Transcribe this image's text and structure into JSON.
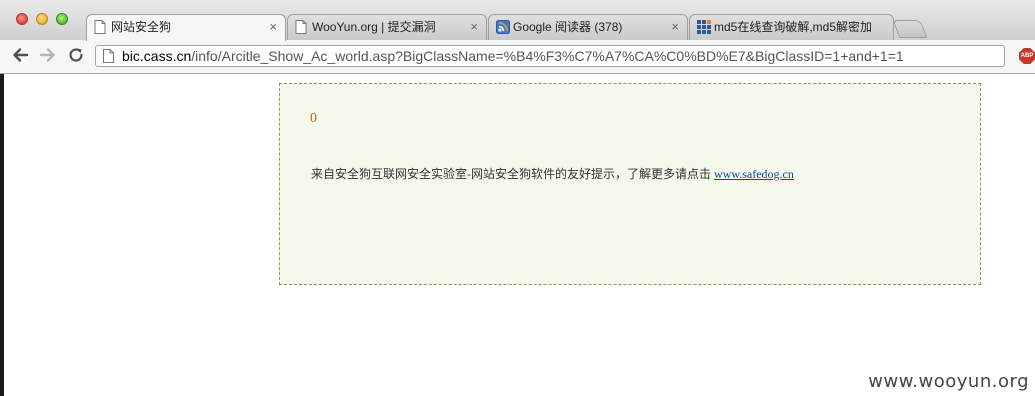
{
  "browser": {
    "tabs": [
      {
        "label": "网站安全狗",
        "icon": "page-icon",
        "active": true
      },
      {
        "label": "WooYun.org | 提交漏洞",
        "icon": "page-icon",
        "active": false
      },
      {
        "label": "Google 阅读器 (378)",
        "icon": "google-reader-icon",
        "active": false
      },
      {
        "label": "md5在线查询破解,md5解密加",
        "icon": "grid-icon",
        "active": false
      }
    ],
    "tab_close_glyph": "×",
    "url_host": "bic.cass.cn",
    "url_path": "/info/Arcitle_Show_Ac_world.asp?BigClassName=%B4%F3%C7%A7%CA%C0%BD%E7&BigClassID=1+and+1=1",
    "adblock_label": "ABP"
  },
  "page": {
    "result_value": "0",
    "message_text": "来自安全狗互联网安全实验室-网站安全狗软件的友好提示，了解更多请点击 ",
    "message_link": "www.safedog.cn"
  },
  "watermark": "www.wooyun.org",
  "colors": {
    "box_background": "#f5f9ec",
    "box_border": "#8c9a55",
    "result_color": "#b4651a",
    "link_color": "#0645ad"
  }
}
